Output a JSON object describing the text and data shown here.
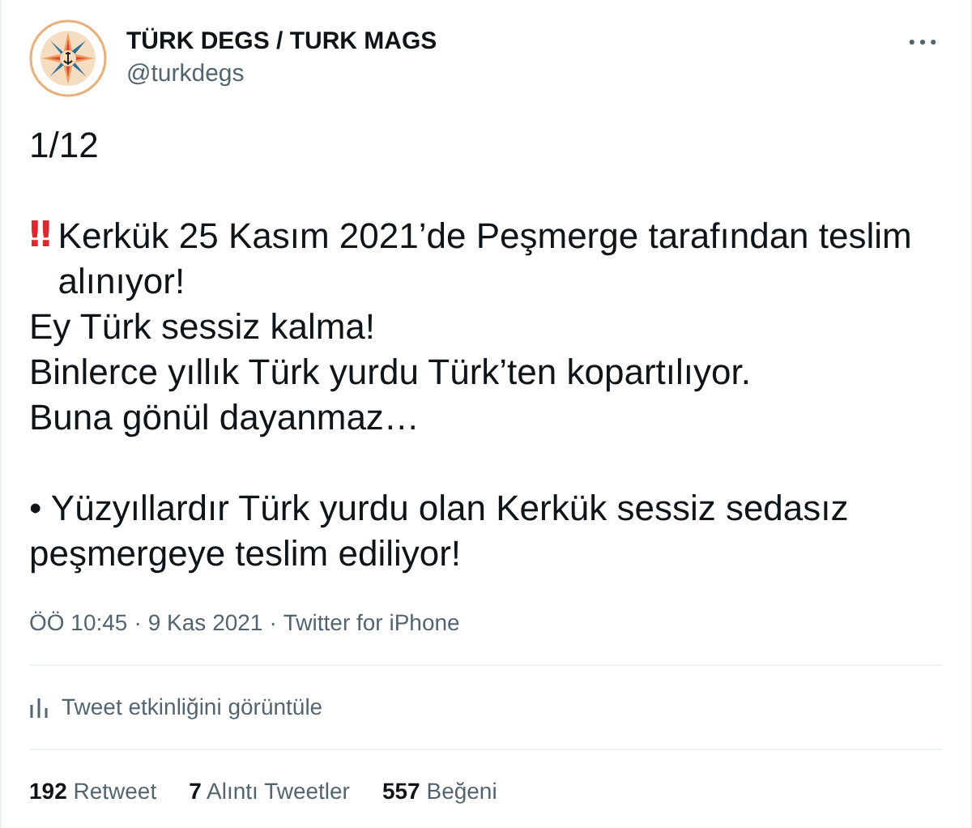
{
  "author": {
    "name": "TÜRK DEGS / TURK MAGS",
    "handle": "@turkdegs"
  },
  "paragraphs": [
    {
      "lines": [
        {
          "text": "1/12"
        }
      ]
    },
    {
      "lines": [
        {
          "mark": "‼",
          "text": "Kerkük 25 Kasım 2021’de Peşmerge tarafından teslim alınıyor!"
        },
        {
          "text": "Ey Türk sessiz kalma!"
        },
        {
          "text": "Binlerce yıllık Türk yurdu Türk’ten kopartılıyor."
        },
        {
          "text": "Buna gönül dayanmaz…"
        }
      ]
    },
    {
      "lines": [
        {
          "text": "• Yüzyıllardır Türk yurdu olan Kerkük sessiz sedasız peşmergeye teslim ediliyor!"
        }
      ]
    }
  ],
  "meta": {
    "time": "ÖÖ 10:45",
    "date": "9 Kas 2021",
    "source": "Twitter for iPhone",
    "separators": [
      "·",
      "·"
    ]
  },
  "activity_link": "Tweet etkinliğini görüntüle",
  "stats": [
    {
      "count": "192",
      "label": "Retweet"
    },
    {
      "count": "7",
      "label": "Alıntı Tweetler"
    },
    {
      "count": "557",
      "label": "Beğeni"
    }
  ]
}
